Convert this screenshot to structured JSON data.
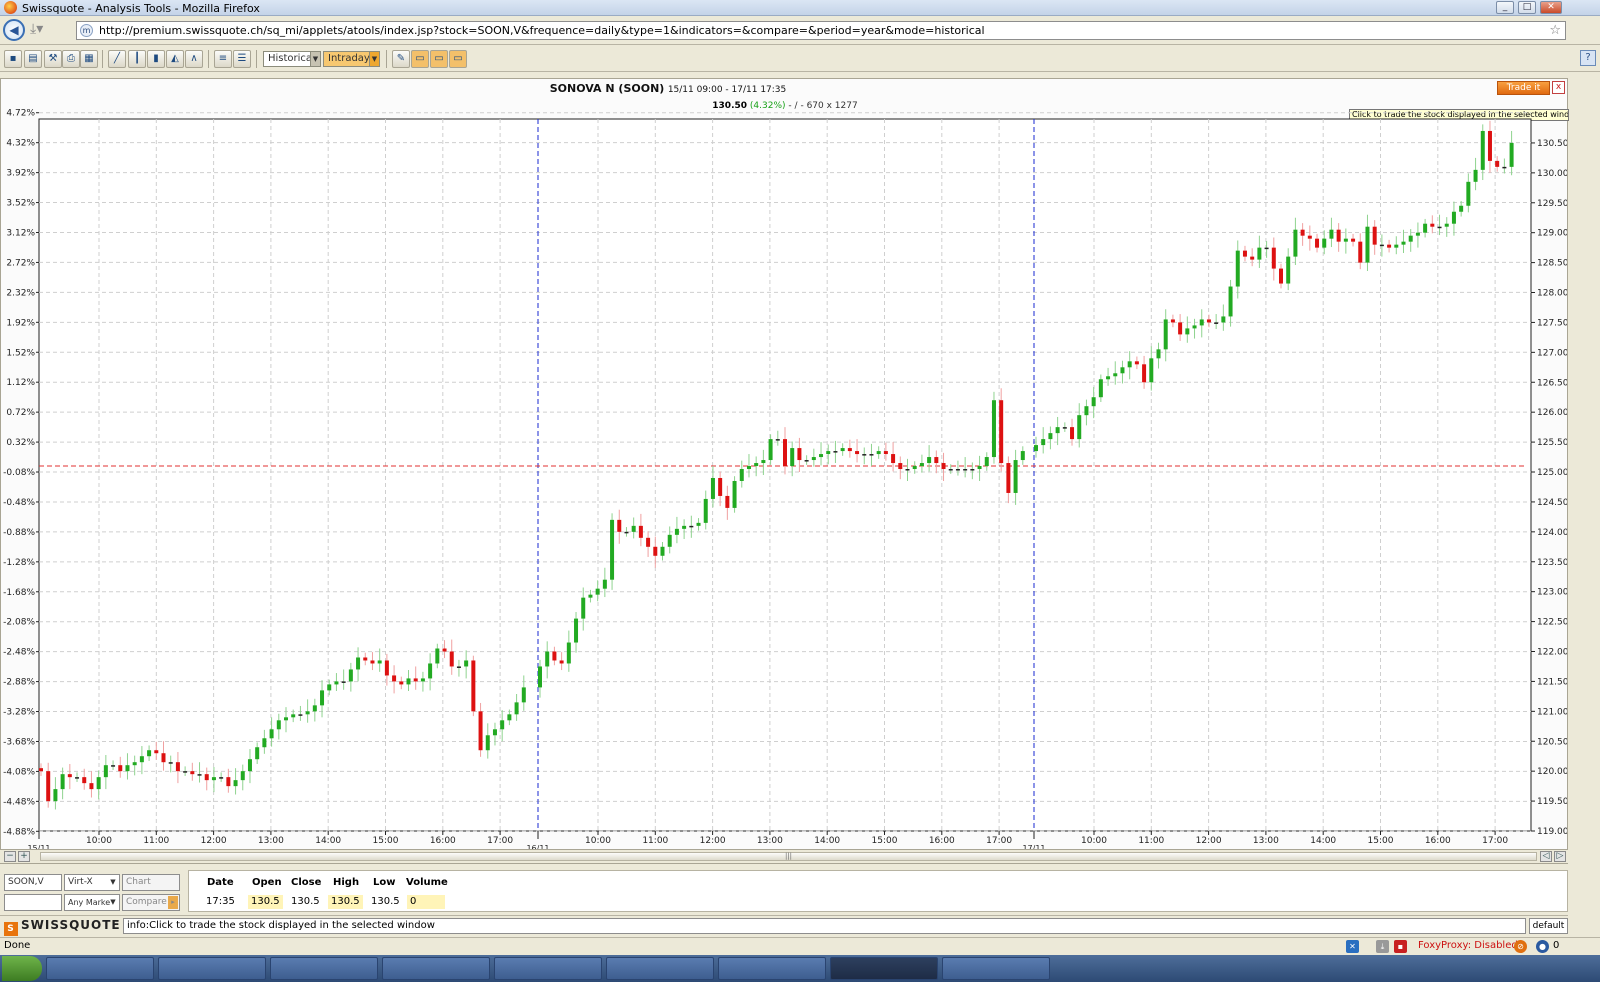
{
  "window": {
    "title": "Swissquote - Analysis Tools - Mozilla Firefox"
  },
  "browser": {
    "url": "http://premium.swissquote.ch/sq_mi/applets/atools/index.jsp?stock=SOON,V&frequence=daily&type=1&indicators=&compare=&period=year&mode=historical"
  },
  "toolbar": {
    "mode_select": "Historical",
    "interval_select": "Intraday"
  },
  "chart_header": {
    "stock": "SONOVA N (SOON)",
    "range": "15/11 09:00 - 17/11 17:35",
    "price": "130.50",
    "change": "(4.32%)",
    "sep1": "-",
    "slash": "/",
    "sep2": "-",
    "dims": "670 x 1277",
    "trade_button": "Trade it",
    "close_icon": "x",
    "tooltip": "Click to trade the stock displayed in the selected window"
  },
  "chart_data": {
    "type": "candlestick",
    "title": "SONOVA N (SOON)",
    "y_right_ticks": [
      "130.50",
      "130.00",
      "129.50",
      "129.00",
      "128.50",
      "128.00",
      "127.50",
      "127.00",
      "126.50",
      "126.00",
      "125.50",
      "125.00",
      "124.50",
      "124.00",
      "123.50",
      "123.00",
      "122.50",
      "122.00",
      "121.50",
      "121.00",
      "120.50",
      "120.00",
      "119.50",
      "119.00"
    ],
    "y_left_ticks": [
      "4.72%",
      "4.32%",
      "3.92%",
      "3.52%",
      "3.12%",
      "2.72%",
      "2.32%",
      "1.92%",
      "1.52%",
      "1.12%",
      "0.72%",
      "0.32%",
      "-0.08%",
      "-0.48%",
      "-0.88%",
      "-1.28%",
      "-1.68%",
      "-2.08%",
      "-2.48%",
      "-2.88%",
      "-3.28%",
      "-3.68%",
      "-4.08%",
      "-4.48%",
      "-4.88%"
    ],
    "x_tick_labels": [
      "10:00",
      "11:00",
      "12:00",
      "13:00",
      "14:00",
      "15:00",
      "16:00",
      "17:00",
      "10:00",
      "11:00",
      "12:00",
      "13:00",
      "14:00",
      "15:00",
      "16:00",
      "17:00",
      "10:00",
      "11:00",
      "12:00",
      "13:00",
      "14:00",
      "15:00",
      "16:00",
      "17:00"
    ],
    "day_labels": [
      "15/11",
      "16/11",
      "17/11"
    ],
    "reference_line": 125.1,
    "ylim": [
      119.0,
      130.9
    ],
    "closes": [
      120.0,
      119.5,
      119.7,
      119.95,
      119.9,
      119.9,
      119.8,
      119.7,
      119.9,
      120.1,
      120.1,
      120.0,
      120.1,
      120.15,
      120.25,
      120.35,
      120.3,
      120.15,
      120.15,
      120.0,
      120.0,
      119.95,
      119.95,
      119.85,
      119.9,
      119.9,
      119.75,
      119.85,
      120.0,
      120.2,
      120.4,
      120.55,
      120.7,
      120.85,
      120.9,
      120.95,
      120.95,
      121.0,
      121.1,
      121.35,
      121.45,
      121.5,
      121.5,
      121.7,
      121.9,
      121.85,
      121.8,
      121.85,
      121.6,
      121.5,
      121.45,
      121.55,
      121.5,
      121.55,
      121.8,
      122.05,
      122.0,
      121.75,
      121.75,
      121.85,
      121.0,
      120.35,
      120.6,
      120.7,
      120.85,
      120.95,
      121.15,
      121.4,
      121.75,
      122.0,
      121.85,
      121.8,
      122.15,
      122.55,
      122.9,
      122.95,
      123.05,
      123.2,
      124.2,
      124.0,
      124.0,
      124.1,
      123.9,
      123.75,
      123.6,
      123.75,
      123.95,
      124.05,
      124.1,
      124.1,
      124.15,
      124.55,
      124.9,
      124.6,
      124.4,
      124.85,
      125.05,
      125.1,
      125.15,
      125.2,
      125.55,
      125.55,
      125.1,
      125.4,
      125.2,
      125.2,
      125.25,
      125.3,
      125.35,
      125.35,
      125.4,
      125.35,
      125.3,
      125.3,
      125.3,
      125.35,
      125.3,
      125.15,
      125.05,
      125.05,
      125.1,
      125.15,
      125.25,
      125.15,
      125.05,
      125.05,
      125.05,
      125.05,
      125.05,
      125.1,
      125.25,
      126.2,
      125.15,
      124.65,
      125.2,
      125.35,
      125.45,
      125.55,
      125.65,
      125.75,
      125.75,
      125.55,
      125.95,
      126.1,
      126.25,
      126.55,
      126.6,
      126.65,
      126.75,
      126.85,
      126.8,
      126.5,
      126.9,
      127.05,
      127.55,
      127.5,
      127.3,
      127.4,
      127.45,
      127.55,
      127.5,
      127.5,
      127.6,
      128.1,
      128.7,
      128.6,
      128.55,
      128.75,
      128.75,
      128.4,
      128.15,
      128.6,
      129.05,
      128.95,
      128.9,
      128.75,
      128.9,
      129.05,
      128.85,
      128.9,
      128.85,
      128.5,
      129.1,
      128.8,
      128.8,
      128.75,
      128.8,
      128.85,
      128.95,
      129.0,
      129.15,
      129.1,
      129.1,
      129.15,
      129.35,
      129.45,
      129.85,
      130.05,
      130.7,
      130.2,
      130.1,
      130.1,
      130.5
    ]
  },
  "bottom": {
    "symbol": "SOON,V",
    "exchange": "Virt-X",
    "chart_btn": "Chart",
    "market": "Any Marke",
    "compare_btn": "Compare",
    "headers": [
      "Date",
      "Open",
      "Close",
      "High",
      "Low",
      "Volume"
    ],
    "values": [
      "17:35",
      "130.5",
      "130.5",
      "130.5",
      "130.5",
      "0"
    ],
    "brand": "SWISSQUOTE",
    "info": "info:Click to trade the stock displayed in the selected window",
    "default": "default"
  },
  "statusbar": {
    "done": "Done",
    "proxy": "FoxyProxy: Disabled",
    "count": "0"
  },
  "colors": {
    "up": "#22aa22",
    "down": "#dd1111",
    "grid": "#c8c8c8",
    "accent": "#e07010"
  }
}
